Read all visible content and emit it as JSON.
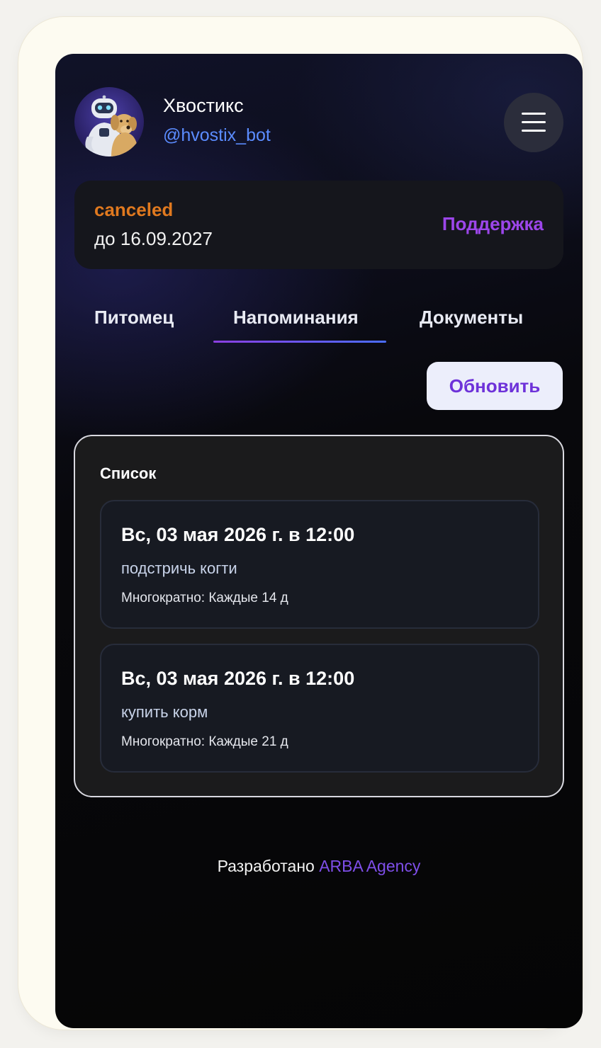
{
  "header": {
    "bot_name": "Хвостикс",
    "bot_handle": "@hvostix_bot",
    "avatar_icon": "robot-with-dog-icon",
    "menu_icon": "hamburger-menu-icon"
  },
  "subscription": {
    "status": "canceled",
    "until": "до 16.09.2027",
    "support_label": "Поддержка"
  },
  "tabs": [
    {
      "label": "Питомец",
      "active": false
    },
    {
      "label": "Напоминания",
      "active": true
    },
    {
      "label": "Документы",
      "active": false
    }
  ],
  "refresh_label": "Обновить",
  "list": {
    "title": "Список",
    "items": [
      {
        "date": "Вс, 03 мая 2026 г. в 12:00",
        "text": "подстричь когти",
        "repeat": "Многократно: Каждые 14 д"
      },
      {
        "date": "Вс, 03 мая 2026 г. в 12:00",
        "text": "купить корм",
        "repeat": "Многократно: Каждые 21 д"
      }
    ]
  },
  "footer": {
    "prefix": "Разработано",
    "link": "ARBA Agency"
  },
  "colors": {
    "status": "#e0791f",
    "accent": "#9c46ea",
    "handle": "#5b8cff",
    "footer_link": "#7e4ee8"
  }
}
